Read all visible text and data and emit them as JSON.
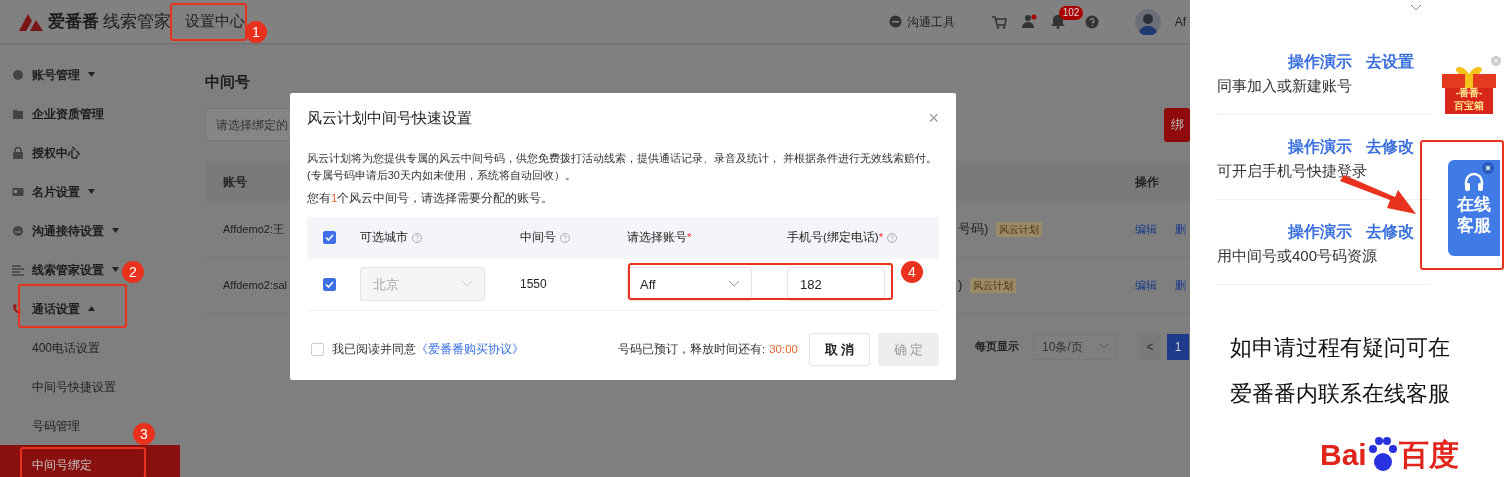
{
  "header": {
    "brand": "爱番番",
    "product": "线索管家",
    "section": "设置中心",
    "tools_label": "沟通工具",
    "notification_count": "102",
    "user": "Af"
  },
  "sidebar": {
    "items": [
      {
        "label": "账号管理",
        "expanded": false
      },
      {
        "label": "企业资质管理"
      },
      {
        "label": "授权中心"
      },
      {
        "label": "名片设置",
        "expanded": false
      },
      {
        "label": "沟通接待设置",
        "expanded": false
      },
      {
        "label": "线索管家设置",
        "expanded": false
      },
      {
        "label": "通话设置",
        "expanded": true,
        "children": [
          {
            "label": "400电话设置",
            "selected": false
          },
          {
            "label": "中间号快捷设置",
            "selected": false
          },
          {
            "label": "号码管理",
            "selected": false
          },
          {
            "label": "中间号绑定",
            "selected": true
          }
        ]
      }
    ]
  },
  "page": {
    "title": "中间号",
    "search_placeholder": "请选择绑定的",
    "bind_button": "绑",
    "table": {
      "columns": [
        "账号",
        "操作"
      ],
      "rows": [
        {
          "account": "Affdemo2:王",
          "number_tail": "号码)",
          "tag": "风云计划",
          "actions": [
            "编辑",
            "删"
          ]
        },
        {
          "account": "Affdemo2:sal",
          "number_tail": ")",
          "tag": "风云计划",
          "actions": [
            "编辑",
            "删"
          ]
        }
      ]
    },
    "pagination": {
      "label": "每页显示",
      "page_size": "10条/页",
      "prev": "<",
      "current_page": "1"
    }
  },
  "modal": {
    "title": "风云计划中间号快速设置",
    "close": "×",
    "description": "风云计划将为您提供专属的风云中间号码，供您免费拨打活动线索，提供通话记录、录音及统计， 并根据条件进行无效线索赔付。(专属号码申请后30天内如未使用，系统将自动回收）。",
    "notice": {
      "prefix": "您有",
      "count": "1",
      "suffix": "个风云中间号，请选择需要分配的账号。"
    },
    "table": {
      "all_checked": true,
      "columns": [
        {
          "label": "可选城市",
          "help": true
        },
        {
          "label": "中间号",
          "help": true
        },
        {
          "label": "请选择账号",
          "required_mark": "*",
          "help": false
        },
        {
          "label": "手机号(绑定电话)",
          "required_mark": "*",
          "help": true
        }
      ],
      "rows": [
        {
          "checked": true,
          "city": "北京",
          "city_disabled": true,
          "number": "1550",
          "account": "Aff",
          "phone": "182"
        }
      ]
    },
    "agreement": {
      "checked": false,
      "text": "我已阅读并同意",
      "link": "《爱番番购买协议》"
    },
    "timer": {
      "label": "号码已预订，释放时间还有:",
      "time": "30:00"
    },
    "buttons": [
      {
        "label": "取 消",
        "disabled": false
      },
      {
        "label": "确 定",
        "disabled": true
      }
    ]
  },
  "side_panel": {
    "rows": [
      {
        "links": [
          "操作演示",
          "去设置"
        ],
        "description": "同事加入或新建账号"
      },
      {
        "links": [
          "操作演示",
          "去修改"
        ],
        "description": "可开启手机号快捷登录"
      },
      {
        "links": [
          "操作演示",
          "去修改"
        ],
        "description": "用中间号或400号码资源"
      }
    ],
    "gift_label": [
      "-番番-",
      "百宝箱"
    ],
    "service_button": [
      "在线",
      "客服"
    ],
    "caption": [
      "如申请过程有疑问可在",
      "爱番番内联系在线客服"
    ],
    "logo_text": [
      "Bai",
      "百度"
    ]
  },
  "annotations": [
    {
      "label": "1"
    },
    {
      "label": "2"
    },
    {
      "label": "3"
    },
    {
      "label": "4"
    }
  ]
}
